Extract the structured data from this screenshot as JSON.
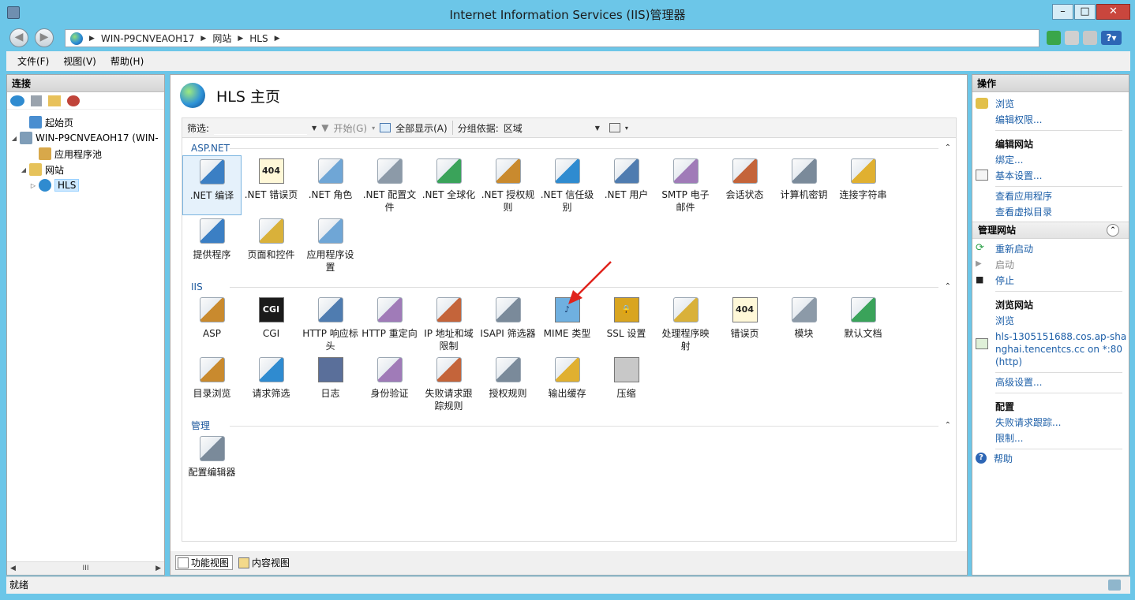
{
  "window": {
    "title": "Internet Information Services (IIS)管理器",
    "min_label": "–",
    "max_label": "□",
    "close_label": "✕"
  },
  "address": {
    "segments": [
      "WIN-P9CNVEAOH17",
      "网站",
      "HLS"
    ]
  },
  "menu": [
    "文件(F)",
    "视图(V)",
    "帮助(H)"
  ],
  "connections": {
    "title": "连接",
    "tree": [
      {
        "label": "起始页",
        "icon": "start-page-icon",
        "indent": 1,
        "expander": ""
      },
      {
        "label": "WIN-P9CNVEAOH17 (WIN-",
        "icon": "server-icon",
        "indent": 0,
        "expander": "◢"
      },
      {
        "label": "应用程序池",
        "icon": "app-pool-icon",
        "indent": 2,
        "expander": ""
      },
      {
        "label": "网站",
        "icon": "sites-folder-icon",
        "indent": 1,
        "expander": "◢"
      },
      {
        "label": "HLS",
        "icon": "globe-icon",
        "indent": 2,
        "expander": "▷",
        "selected": true
      }
    ],
    "scroll_label": "III"
  },
  "main": {
    "page_title": "HLS 主页",
    "filter": {
      "label": "筛选:",
      "start": "开始(G)",
      "show_all": "全部显示(A)",
      "group_by_label": "分组依据:",
      "group_by_value": "区域"
    },
    "sections": [
      {
        "title": "ASP.NET",
        "items": [
          {
            "label": ".NET 编译",
            "icon": "net-compile-icon",
            "selected": true
          },
          {
            "label": ".NET 错误页",
            "icon": "net-error-page-icon"
          },
          {
            "label": ".NET 角色",
            "icon": "net-roles-icon"
          },
          {
            "label": ".NET 配置文件",
            "icon": "net-profile-icon"
          },
          {
            "label": ".NET 全球化",
            "icon": "net-globalization-icon"
          },
          {
            "label": ".NET 授权规则",
            "icon": "net-authorization-icon"
          },
          {
            "label": ".NET 信任级别",
            "icon": "net-trust-level-icon"
          },
          {
            "label": ".NET 用户",
            "icon": "net-users-icon"
          },
          {
            "label": "SMTP 电子邮件",
            "icon": "smtp-email-icon"
          },
          {
            "label": "会话状态",
            "icon": "session-state-icon"
          },
          {
            "label": "计算机密钥",
            "icon": "machine-key-icon"
          },
          {
            "label": "连接字符串",
            "icon": "connection-strings-icon"
          },
          {
            "label": "提供程序",
            "icon": "providers-icon"
          },
          {
            "label": "页面和控件",
            "icon": "pages-controls-icon"
          },
          {
            "label": "应用程序设置",
            "icon": "app-settings-icon"
          }
        ]
      },
      {
        "title": "IIS",
        "items": [
          {
            "label": "ASP",
            "icon": "asp-icon"
          },
          {
            "label": "CGI",
            "icon": "cgi-icon"
          },
          {
            "label": "HTTP 响应标头",
            "icon": "http-response-headers-icon"
          },
          {
            "label": "HTTP 重定向",
            "icon": "http-redirect-icon"
          },
          {
            "label": "IP 地址和域限制",
            "icon": "ip-domain-restrictions-icon"
          },
          {
            "label": "ISAPI 筛选器",
            "icon": "isapi-filters-icon"
          },
          {
            "label": "MIME 类型",
            "icon": "mime-types-icon"
          },
          {
            "label": "SSL 设置",
            "icon": "ssl-settings-icon"
          },
          {
            "label": "处理程序映射",
            "icon": "handler-mappings-icon"
          },
          {
            "label": "错误页",
            "icon": "error-pages-icon"
          },
          {
            "label": "模块",
            "icon": "modules-icon"
          },
          {
            "label": "默认文档",
            "icon": "default-document-icon"
          },
          {
            "label": "目录浏览",
            "icon": "directory-browsing-icon"
          },
          {
            "label": "请求筛选",
            "icon": "request-filtering-icon"
          },
          {
            "label": "日志",
            "icon": "logging-icon"
          },
          {
            "label": "身份验证",
            "icon": "authentication-icon"
          },
          {
            "label": "失败请求跟踪规则",
            "icon": "failed-request-tracing-icon"
          },
          {
            "label": "授权规则",
            "icon": "authorization-rules-icon"
          },
          {
            "label": "输出缓存",
            "icon": "output-caching-icon"
          },
          {
            "label": "压缩",
            "icon": "compression-icon"
          }
        ]
      },
      {
        "title": "管理",
        "items": [
          {
            "label": "配置编辑器",
            "icon": "configuration-editor-icon"
          }
        ]
      }
    ],
    "view_tabs": [
      {
        "label": "功能视图",
        "active": true
      },
      {
        "label": "内容视图",
        "active": false
      }
    ]
  },
  "actions": {
    "title": "操作",
    "groups": [
      {
        "items": [
          {
            "label": "浏览",
            "icon": "explore-icon"
          },
          {
            "label": "编辑权限...",
            "icon": ""
          }
        ]
      },
      {
        "heading": "编辑网站",
        "items": [
          {
            "label": "绑定...",
            "icon": ""
          },
          {
            "label": "基本设置...",
            "icon": "settings-icon"
          }
        ]
      },
      {
        "items": [
          {
            "label": "查看应用程序",
            "icon": ""
          },
          {
            "label": "查看虚拟目录",
            "icon": ""
          }
        ]
      }
    ],
    "manage": {
      "title": "管理网站",
      "items": [
        {
          "label": "重新启动",
          "icon": "restart-icon",
          "disabled": false
        },
        {
          "label": "启动",
          "icon": "start-icon",
          "disabled": true
        },
        {
          "label": "停止",
          "icon": "stop-icon",
          "disabled": false
        }
      ],
      "browse_heading": "浏览网站",
      "browse_label": "浏览",
      "browse_url": "hls-1305151688.cos.ap-shanghai.tencentcs.cc on *:80 (http)",
      "advanced": "高级设置...",
      "config_heading": "配置",
      "config_items": [
        "失败请求跟踪...",
        "限制..."
      ],
      "help": "帮助"
    }
  },
  "status": {
    "text": "就绪"
  },
  "colors": {
    "frame": "#6cc6e8",
    "link": "#1d5fa8",
    "section_title": "#1e5a9e",
    "arrow": "#e0231c"
  }
}
